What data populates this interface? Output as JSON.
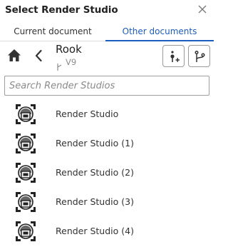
{
  "dialog": {
    "title": "Select Render Studio"
  },
  "tabs": [
    {
      "label": "Current document",
      "active": false
    },
    {
      "label": "Other documents",
      "active": true
    }
  ],
  "nav": {
    "document_name": "Rook",
    "version_label": "V9"
  },
  "search": {
    "placeholder": "Search Render Studios",
    "value": ""
  },
  "items": [
    {
      "label": "Render Studio"
    },
    {
      "label": "Render Studio (1)"
    },
    {
      "label": "Render Studio (2)"
    },
    {
      "label": "Render Studio (3)"
    },
    {
      "label": "Render Studio (4)"
    }
  ],
  "icons": {
    "close": "close-icon",
    "home": "home-icon",
    "back": "chevron-left-icon",
    "version": "version-icon",
    "insert": "insert-icon",
    "branch": "branch-icon",
    "render_studio": "render-studio-icon"
  },
  "colors": {
    "accent": "#1d5dbe",
    "text": "#333333",
    "muted": "#8c8c8c"
  }
}
